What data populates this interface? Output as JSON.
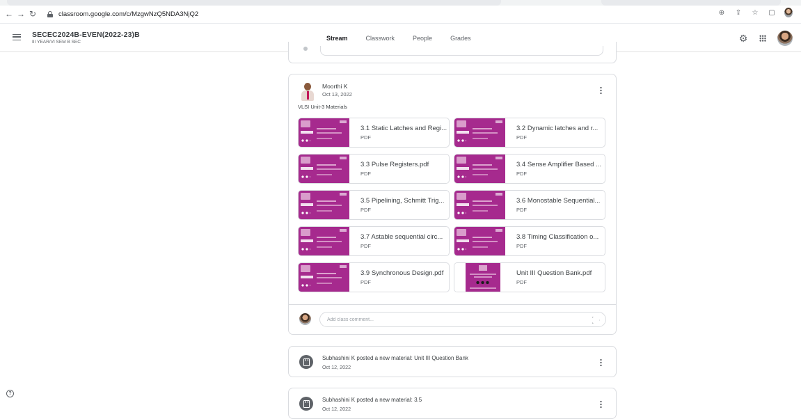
{
  "browser": {
    "url": "classroom.google.com/c/MzgwNzQ5NDA3NjQ2",
    "back_icon": "arrow-left-icon",
    "forward_icon": "arrow-right-icon",
    "reload_icon": "reload-icon"
  },
  "header": {
    "class_name": "SECEC2024B-EVEN(2022-23)B",
    "section": "III YEAR/VI SEM B SEC",
    "tabs": [
      {
        "label": "Stream",
        "active": true
      },
      {
        "label": "Classwork",
        "active": false
      },
      {
        "label": "People",
        "active": false
      },
      {
        "label": "Grades",
        "active": false
      }
    ]
  },
  "post": {
    "author": "Moorthi K",
    "date": "Oct 13, 2022",
    "text": "VLSI Unit-3 Materials",
    "attachments": [
      {
        "title": "3.1 Static Latches and Regi...",
        "type": "PDF"
      },
      {
        "title": "3.2 Dynamic latches and r...",
        "type": "PDF"
      },
      {
        "title": "3.3 Pulse Registers.pdf",
        "type": "PDF"
      },
      {
        "title": "3.4 Sense Amplifier Based ...",
        "type": "PDF"
      },
      {
        "title": "3.5 Pipelining, Schmitt Trig...",
        "type": "PDF"
      },
      {
        "title": "3.6 Monostable Sequential...",
        "type": "PDF"
      },
      {
        "title": "3.7 Astable sequential circ...",
        "type": "PDF"
      },
      {
        "title": "3.8 Timing Classification o...",
        "type": "PDF"
      },
      {
        "title": "3.9 Synchronous Design.pdf",
        "type": "PDF"
      },
      {
        "title": "Unit III Question Bank.pdf",
        "type": "PDF"
      }
    ],
    "comment_placeholder": "Add class comment..."
  },
  "materials": [
    {
      "title": "Subhashini K posted a new material: Unit III Question Bank",
      "date": "Oct 12, 2022"
    },
    {
      "title": "Subhashini K posted a new material: 3.5",
      "date": "Oct 12, 2022"
    }
  ],
  "colors": {
    "thumbnail": "#a62a8e",
    "border": "#dadce0",
    "text": "#3c4043"
  }
}
